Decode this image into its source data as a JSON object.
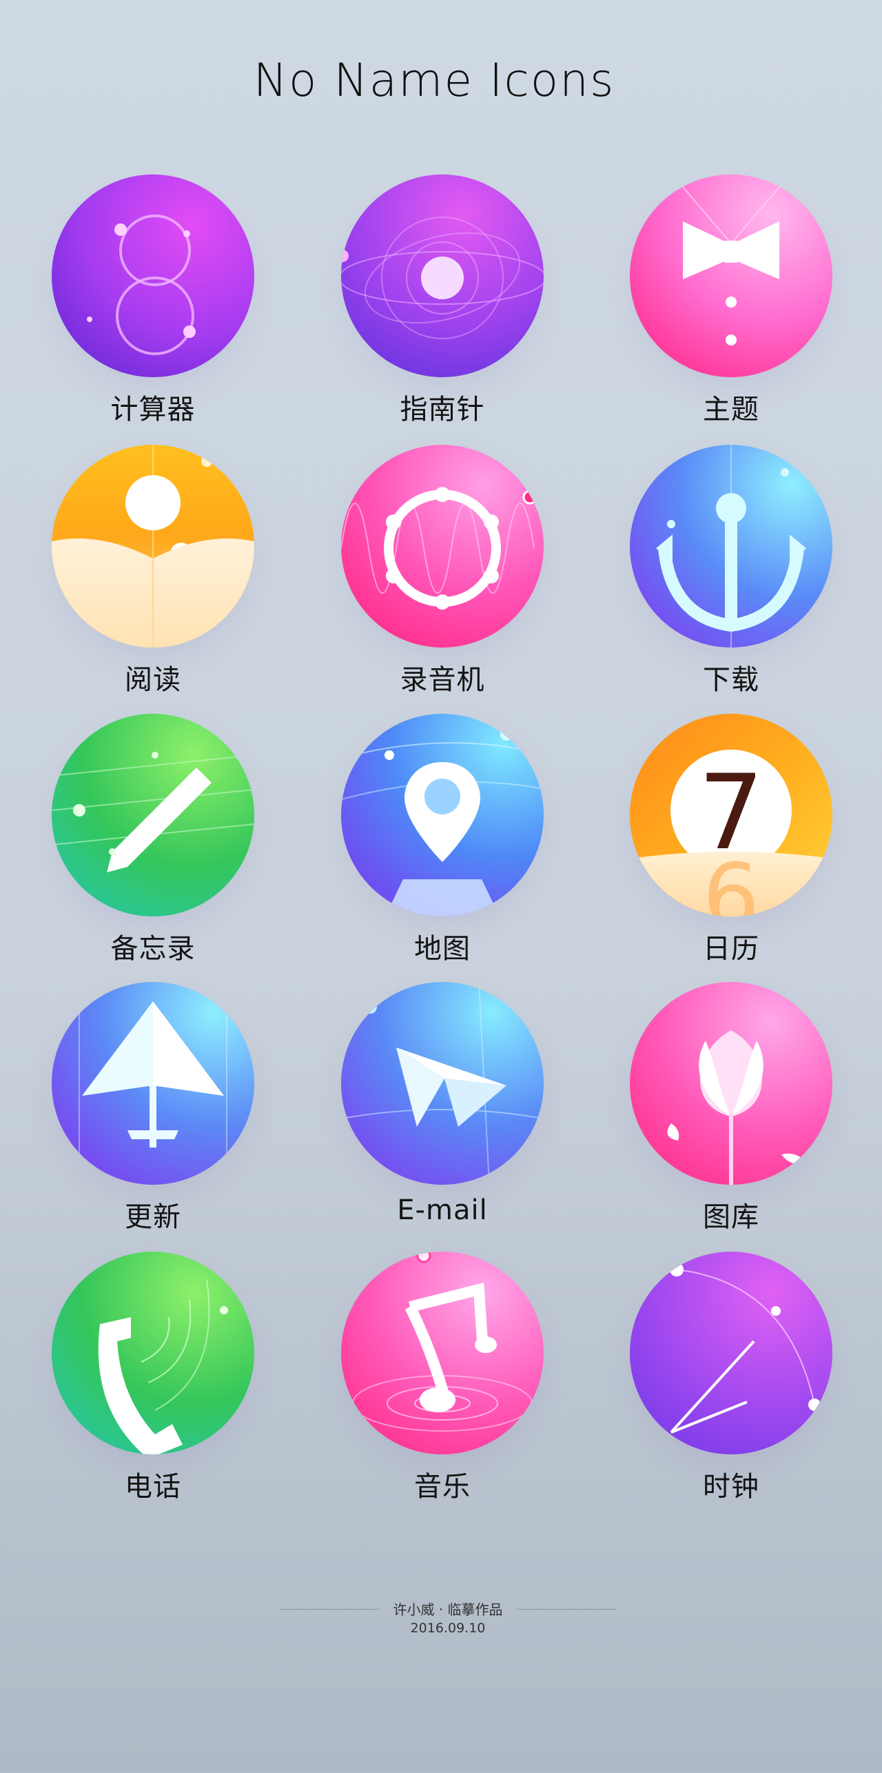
{
  "title": "No Name Icons",
  "icons": [
    {
      "label": "计算器",
      "icon": "calculator-icon"
    },
    {
      "label": "指南针",
      "icon": "compass-icon"
    },
    {
      "label": "主题",
      "icon": "theme-bowtie-icon"
    },
    {
      "label": "阅读",
      "icon": "reading-book-icon"
    },
    {
      "label": "录音机",
      "icon": "recorder-icon"
    },
    {
      "label": "下载",
      "icon": "download-anchor-icon"
    },
    {
      "label": "备忘录",
      "icon": "memo-pen-icon"
    },
    {
      "label": "地图",
      "icon": "map-pin-icon"
    },
    {
      "label": "日历",
      "icon": "calendar-icon"
    },
    {
      "label": "更新",
      "icon": "update-plane-icon"
    },
    {
      "label": "E-mail",
      "icon": "email-paper-plane-icon"
    },
    {
      "label": "图库",
      "icon": "gallery-flower-icon"
    },
    {
      "label": "电话",
      "icon": "phone-icon"
    },
    {
      "label": "音乐",
      "icon": "music-note-icon"
    },
    {
      "label": "时钟",
      "icon": "clock-icon"
    }
  ],
  "calendar": {
    "day": "7",
    "prev_day": "6"
  },
  "calculator": {
    "digit": "8"
  },
  "footer": {
    "credit": "许小威 · 临摹作品",
    "date": "2016.09.10"
  },
  "colors": {
    "background_top": "#cfd9e3",
    "background_bottom": "#afbac6",
    "purple": "#8a3cf0",
    "pink": "#ff3f9c",
    "blue": "#4a6cf5",
    "green": "#2ec25a",
    "orange": "#ffb400"
  }
}
